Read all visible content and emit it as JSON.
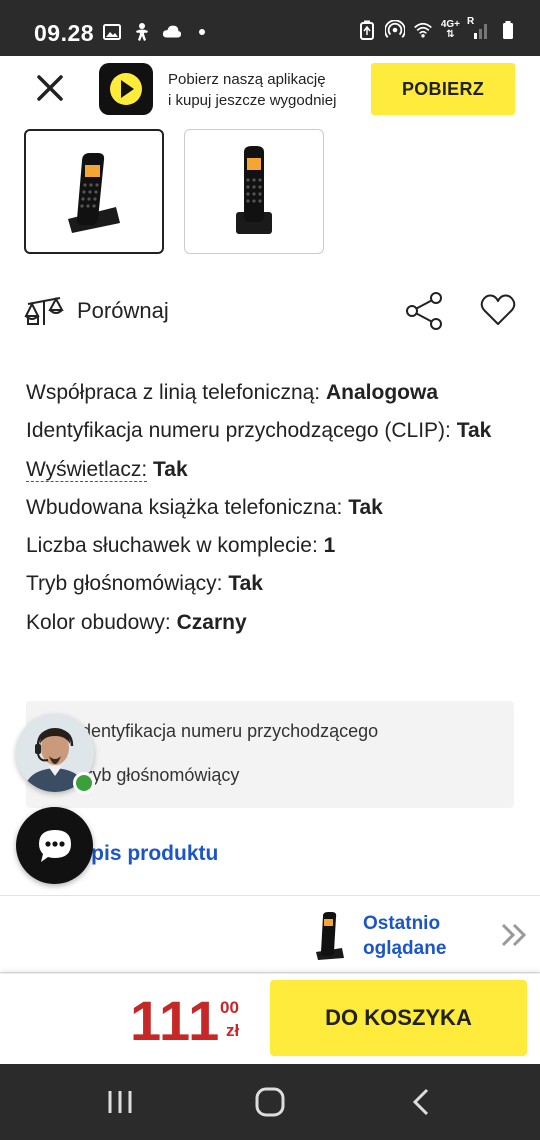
{
  "status_bar": {
    "time": "09.28",
    "network": "4G+",
    "network_sub": "R"
  },
  "banner": {
    "promo_line1": "Pobierz naszą aplikację",
    "promo_line2": "i kupuj jeszcze wygodniej",
    "get_button": "POBIERZ",
    "brand_color": "#ffeb3b"
  },
  "thumbnails": [
    {
      "icon": "phone-with-base-angled",
      "selected": true
    },
    {
      "icon": "phone-with-base-front",
      "selected": false
    }
  ],
  "actions": {
    "compare_label": "Porównaj"
  },
  "specs": [
    {
      "label": "Współpraca z linią telefoniczną:",
      "value": "Analogowa"
    },
    {
      "label": "Identyfikacja numeru przychodzącego (CLIP):",
      "value": "Tak"
    },
    {
      "label": "Wyświetlacz:",
      "value": "Tak"
    },
    {
      "label": "Wbudowana książka telefoniczna:",
      "value": "Tak"
    },
    {
      "label": "Liczba słuchawek w komplecie:",
      "value": "1"
    },
    {
      "label": "Tryb głośnomówiący:",
      "value": "Tak"
    },
    {
      "label": "Kolor obudowy:",
      "value": "Czarny"
    }
  ],
  "features": [
    "Identyfikacja numeru przychodzącego",
    "Tryb głośnomówiący"
  ],
  "description_link": "z opis produktu",
  "recently_viewed": {
    "line1": "Ostatnio",
    "line2": "oglądane"
  },
  "cart": {
    "price_main": "111",
    "price_cents": "00",
    "currency": "zł",
    "button": "DO KOSZYKA",
    "price_color": "#c62828"
  }
}
